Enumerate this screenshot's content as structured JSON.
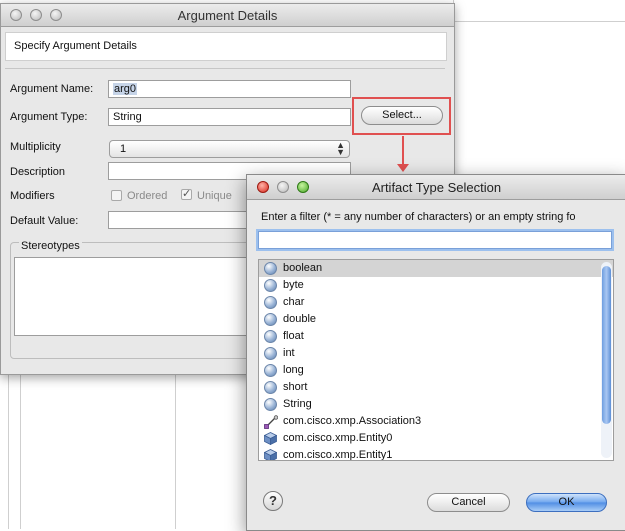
{
  "argument_dialog": {
    "title": "Argument Details",
    "header": "Specify Argument Details",
    "name_label": "Argument Name:",
    "name_value": "arg0",
    "type_label": "Argument Type:",
    "type_value": "String",
    "select_button": "Select...",
    "multiplicity_label": "Multiplicity",
    "multiplicity_value": "1",
    "description_label": "Description",
    "modifiers_label": "Modifiers",
    "ordered_label": "Ordered",
    "unique_label": "Unique",
    "default_label": "Default Value:",
    "stereotypes_label": "Stereotypes"
  },
  "type_dialog": {
    "title": "Artifact Type Selection",
    "filter_label": "Enter a filter (* = any number of characters) or an empty string fo",
    "filter_value": "",
    "items": [
      {
        "label": "boolean",
        "icon": "primitive-type-icon",
        "selected": true
      },
      {
        "label": "byte",
        "icon": "primitive-type-icon"
      },
      {
        "label": "char",
        "icon": "primitive-type-icon"
      },
      {
        "label": "double",
        "icon": "primitive-type-icon"
      },
      {
        "label": "float",
        "icon": "primitive-type-icon"
      },
      {
        "label": "int",
        "icon": "primitive-type-icon"
      },
      {
        "label": "long",
        "icon": "primitive-type-icon"
      },
      {
        "label": "short",
        "icon": "primitive-type-icon"
      },
      {
        "label": "String",
        "icon": "primitive-type-icon"
      },
      {
        "label": "com.cisco.xmp.Association3",
        "icon": "association-icon"
      },
      {
        "label": "com.cisco.xmp.Entity0",
        "icon": "entity-icon"
      },
      {
        "label": "com.cisco.xmp.Entity1",
        "icon": "entity-icon"
      }
    ],
    "cancel_button": "Cancel",
    "ok_button": "OK",
    "help_button": "?"
  },
  "colors": {
    "highlight": "#e05050",
    "ok_button": "#4f8de4",
    "selection": "#d4d4d4"
  }
}
